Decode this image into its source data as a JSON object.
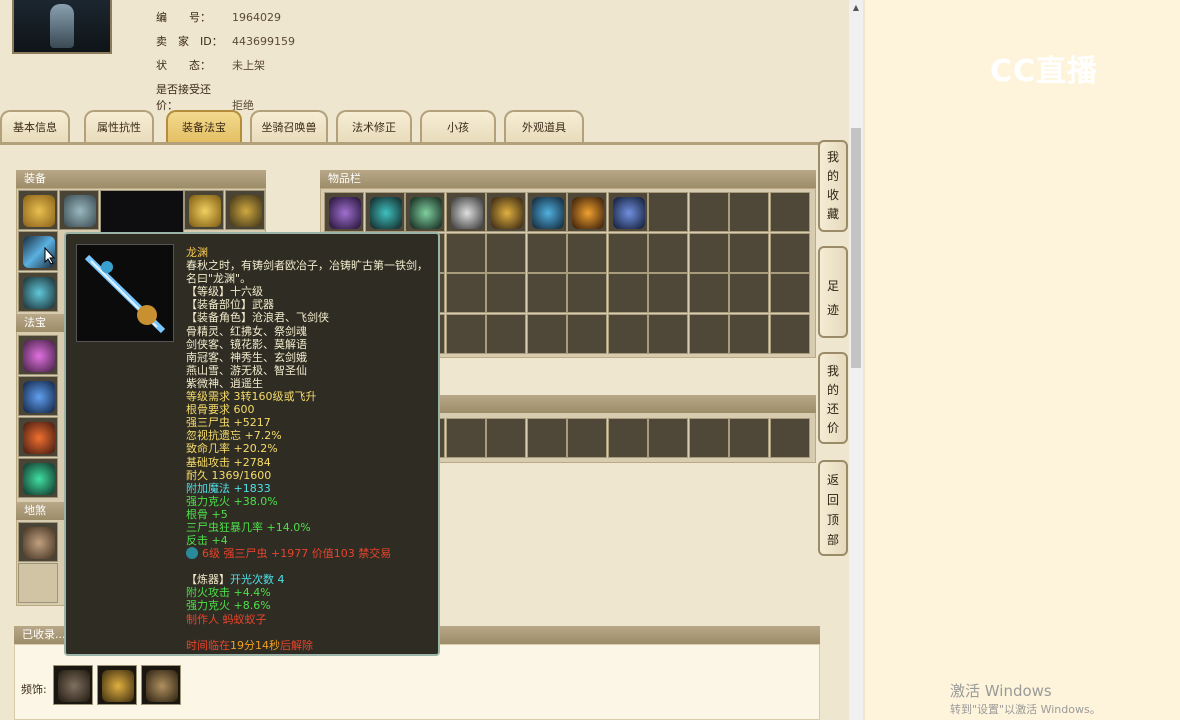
{
  "info": {
    "number_label": "编　　号：",
    "number_value": "1964029",
    "seller_label": "卖　家　ID：",
    "seller_value": "443699159",
    "status_label": "状　　态：",
    "status_value": "未上架",
    "counter_label": "是否接受还价：",
    "counter_value": "拒绝"
  },
  "tabs": [
    "基本信息",
    "属性抗性",
    "装备法宝",
    "坐骑召唤兽",
    "法术修正",
    "小孩",
    "外观道具"
  ],
  "sections": {
    "equipment": "装备",
    "inventory": "物品栏",
    "fabao": "法宝",
    "disha": "地煞星...",
    "collected": "已收录..."
  },
  "bottom": {
    "label": "频饰:"
  },
  "side_buttons": {
    "favorites": "我的收藏",
    "footprint": "足迹",
    "my_offer": "我的还价",
    "back_top": "返回顶部"
  },
  "tooltip": {
    "name": "龙渊",
    "lines": [
      {
        "t": "春秋之时，有铸剑者欧冶子，冶铸旷古第一铁剑，",
        "c": "c-white"
      },
      {
        "t": "名曰\"龙渊\"。",
        "c": "c-white"
      },
      {
        "t": "【等级】十六级",
        "c": "c-white"
      },
      {
        "t": "【装备部位】武器",
        "c": "c-white"
      },
      {
        "t": "【装备角色】沧浪君、飞剑侠",
        "c": "c-white"
      },
      {
        "t": "骨精灵、红拂女、祭剑魂",
        "c": "c-white"
      },
      {
        "t": "剑侠客、镜花影、莫解语",
        "c": "c-white"
      },
      {
        "t": "南冠客、神秀生、玄剑娥",
        "c": "c-white"
      },
      {
        "t": "燕山雪、游无极、智圣仙",
        "c": "c-white"
      },
      {
        "t": "紫微神、逍遥生",
        "c": "c-white"
      },
      {
        "t": "等级需求 3转160级或飞升",
        "c": "c-yellow"
      },
      {
        "t": "根骨要求 600",
        "c": "c-yellow"
      },
      {
        "t": "强三尸虫 +5217",
        "c": "c-yellow"
      },
      {
        "t": "忽视抗遗忘 +7.2%",
        "c": "c-yellow"
      },
      {
        "t": "致命几率 +20.2%",
        "c": "c-yellow"
      },
      {
        "t": "基础攻击 +2784",
        "c": "c-yellow"
      },
      {
        "t": "耐久 1369/1600",
        "c": "c-yellow"
      },
      {
        "t": "附加魔法 +1833",
        "c": "c-cyan"
      },
      {
        "t": "强力克火 +38.0%",
        "c": "c-green"
      },
      {
        "t": "根骨 +5",
        "c": "c-green"
      },
      {
        "t": "三尸虫狂暴几率 +14.0%",
        "c": "c-green"
      },
      {
        "t": "反击 +4",
        "c": "c-green"
      }
    ],
    "gem_line": "6级 强三尸虫 +1977 价值103 禁交易",
    "refine_head": "【炼器】",
    "refine_value": "开光次数 4",
    "refine_lines": [
      {
        "t": "附火攻击 +4.4%",
        "c": "c-green"
      },
      {
        "t": "强力克火 +8.6%",
        "c": "c-green"
      },
      {
        "t": "制作人 蚂蚁蚁子",
        "c": "c-red"
      }
    ],
    "time_prefix": "时间临在",
    "time_value": "19分14秒",
    "time_suffix": "后解除"
  },
  "overlay": {
    "logo": "CC直播",
    "activate_title": "激活 Windows",
    "activate_sub": "转到\"设置\"以激活 Windows。"
  },
  "colors": {
    "tab_active": "#e4c064",
    "tooltip_bg": "#2f2c23",
    "name": "#f6c94c"
  }
}
